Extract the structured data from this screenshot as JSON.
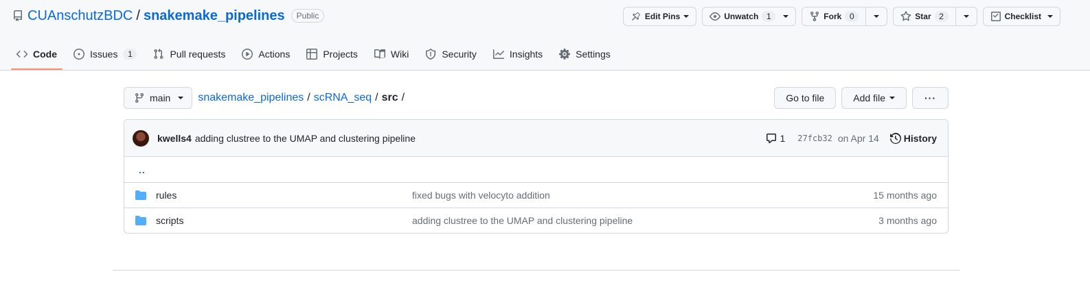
{
  "repo": {
    "owner": "CUAnschutzBDC",
    "separator": "/",
    "name": "snakemake_pipelines",
    "visibility": "Public"
  },
  "header_actions": {
    "edit_pins": "Edit Pins",
    "unwatch": "Unwatch",
    "unwatch_count": "1",
    "fork": "Fork",
    "fork_count": "0",
    "star": "Star",
    "star_count": "2",
    "checklist": "Checklist"
  },
  "tabs": [
    {
      "label": "Code",
      "icon": "code-icon",
      "selected": true
    },
    {
      "label": "Issues",
      "icon": "issue-opened-icon",
      "count": "1"
    },
    {
      "label": "Pull requests",
      "icon": "git-pull-request-icon"
    },
    {
      "label": "Actions",
      "icon": "play-icon"
    },
    {
      "label": "Projects",
      "icon": "table-icon"
    },
    {
      "label": "Wiki",
      "icon": "book-icon"
    },
    {
      "label": "Security",
      "icon": "shield-icon"
    },
    {
      "label": "Insights",
      "icon": "graph-icon"
    },
    {
      "label": "Settings",
      "icon": "gear-icon"
    }
  ],
  "branch": "main",
  "breadcrumb": {
    "items": [
      "snakemake_pipelines",
      "scRNA_seq"
    ],
    "current": "src",
    "separator": "/"
  },
  "toolbar": {
    "go_to_file": "Go to file",
    "add_file": "Add file",
    "more": "···"
  },
  "latest_commit": {
    "author": "kwells4",
    "message": "adding clustree to the UMAP and clustering pipeline",
    "comments": "1",
    "sha": "27fcb32",
    "date": "on Apr 14",
    "history_label": "History"
  },
  "parent_dir": "..",
  "files": [
    {
      "name": "rules",
      "type": "folder",
      "message": "fixed bugs with velocyto addition",
      "age": "15 months ago"
    },
    {
      "name": "scripts",
      "type": "folder",
      "message": "adding clustree to the UMAP and clustering pipeline",
      "age": "3 months ago"
    }
  ],
  "colors": {
    "link": "#0969da",
    "tab_underline": "#fd8c73",
    "folder": "#54aeff",
    "header_bg": "#f6f8fa"
  }
}
